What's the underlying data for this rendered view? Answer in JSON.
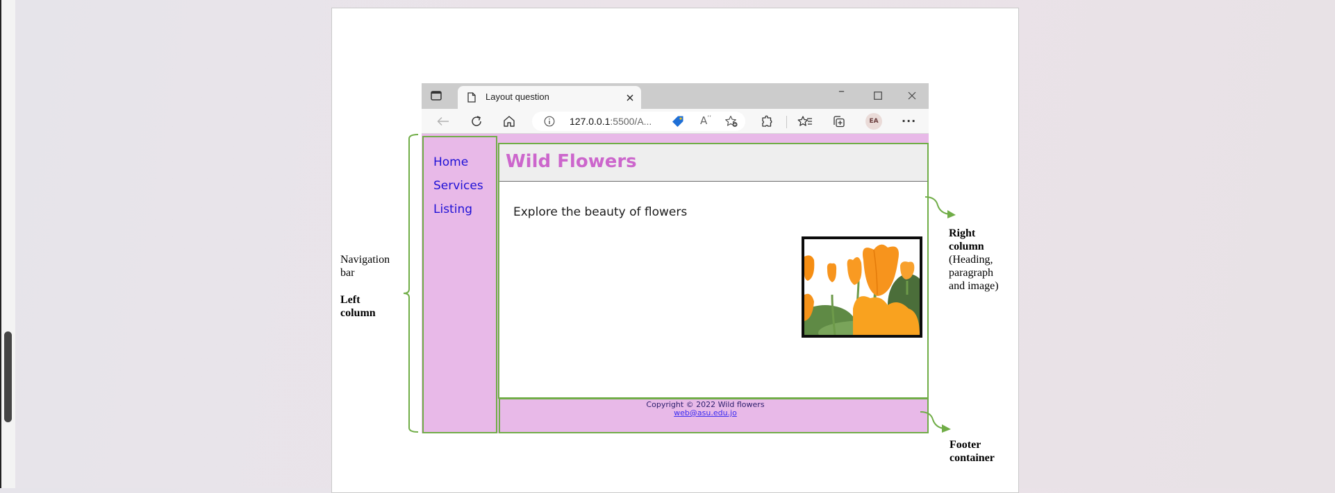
{
  "browser": {
    "tab_title": "Layout question",
    "address_host": "127.0.0.1",
    "address_rest": ":5500/A...",
    "avatar_initials": "EA",
    "more_label": "···",
    "icons": [
      "sidebar-toggle-icon",
      "page-icon",
      "close-tab-icon",
      "new-tab-icon",
      "back-icon",
      "refresh-icon",
      "home-icon",
      "info-icon",
      "coupon-tag-icon",
      "read-aloud-icon",
      "add-favorite-icon",
      "extensions-icon",
      "favorites-icon",
      "collections-icon",
      "more-icon",
      "minimize-icon",
      "maximize-icon",
      "close-window-icon"
    ]
  },
  "site": {
    "nav": [
      {
        "label": "Home"
      },
      {
        "label": "Services"
      },
      {
        "label": "Listing"
      }
    ],
    "title": "Wild Flowers",
    "intro": "Explore the beauty of flowers",
    "image_alt": "Orange poppy flowers",
    "footer": {
      "copyright": "Copyright © 2022 Wild flowers",
      "email": "web@asu.edu.jo"
    }
  },
  "annotations": {
    "nav_label_1": "Navigation",
    "nav_label_2": "bar",
    "left_col_1": "Left",
    "left_col_2": "column",
    "right_col_1": "Right",
    "right_col_2": "column",
    "right_col_3": "(Heading,",
    "right_col_4": "paragraph",
    "right_col_5": "and image)",
    "footer_1": "Footer",
    "footer_2": "container"
  },
  "colors": {
    "nav_background": "#e8b9e8",
    "annotation_green": "#70ad47",
    "title": "#cc66cc",
    "link": "#1f11d6",
    "header_background": "#eeeeee"
  }
}
